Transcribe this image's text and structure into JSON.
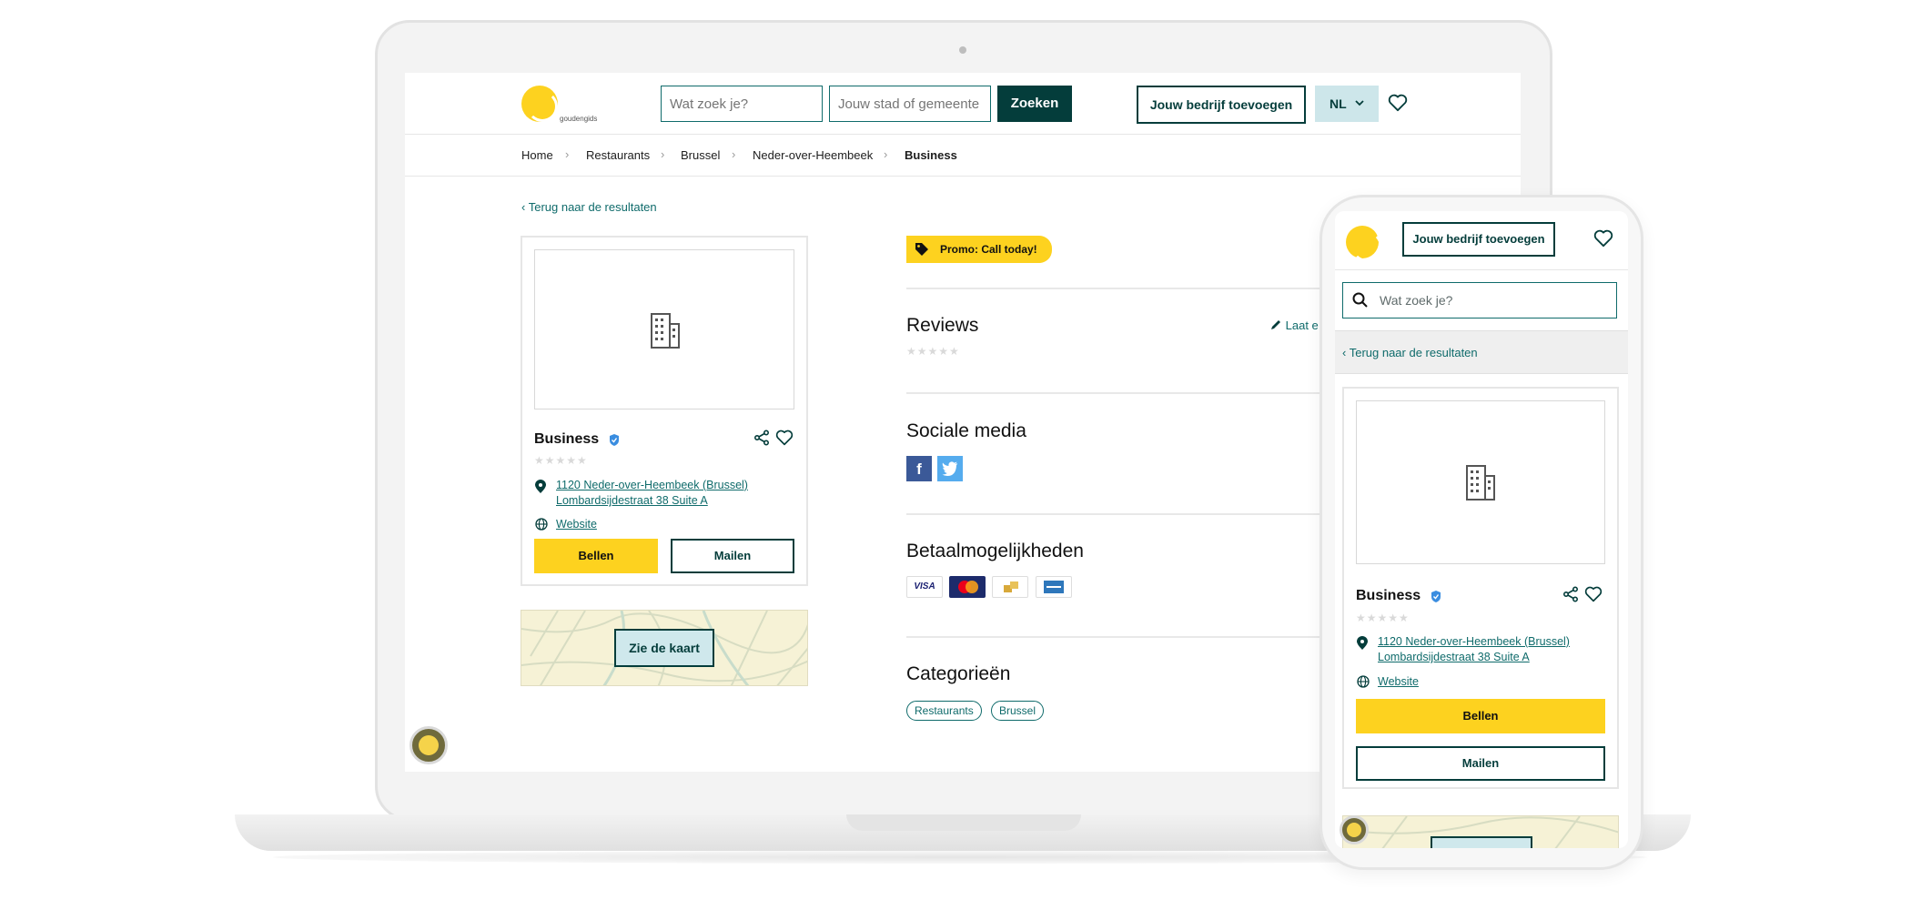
{
  "header": {
    "logo_text": "goudengids",
    "search_placeholder": "Wat zoek je?",
    "location_placeholder": "Jouw stad of gemeente",
    "search_button": "Zoeken",
    "add_business_button": "Jouw bedrijf toevoegen",
    "language": "NL"
  },
  "breadcrumb": {
    "items": [
      "Home",
      "Restaurants",
      "Brussel",
      "Neder-over-Heembeek",
      "Business"
    ]
  },
  "back_link": "Terug naar de resultaten",
  "business": {
    "name": "Business",
    "address_line1": "1120 Neder-over-Heembeek (Brussel)",
    "address_line2": "Lombardsijdestraat 38 Suite A",
    "website": "Website",
    "call_button": "Bellen",
    "mail_button": "Mailen",
    "rating_stars": 0
  },
  "map": {
    "button": "Zie de kaart"
  },
  "promo": "Promo: Call today!",
  "reviews": {
    "title": "Reviews",
    "write_link": "Laat e"
  },
  "social": {
    "title": "Sociale media"
  },
  "payment": {
    "title": "Betaalmogelijkheden",
    "methods": [
      "VISA",
      "MasterCard",
      "cash",
      "AMEX"
    ]
  },
  "categories": {
    "title": "Categorieën",
    "items": [
      "Restaurants",
      "Brussel"
    ]
  },
  "mobile": {
    "add_business_button": "Jouw bedrijf toevoegen",
    "search_placeholder": "Wat zoek je?",
    "back_link": "Terug naar de resultaten",
    "name": "Business",
    "address_line1": "1120 Neder-over-Heembeek (Brussel)",
    "address_line2": "Lombardsijdestraat 38 Suite A",
    "website": "Website",
    "call_button": "Bellen",
    "mail_button": "Mailen"
  },
  "colors": {
    "brand_yellow": "#fdd21f",
    "brand_dark": "#043d3b",
    "link_teal": "#0f6b6b",
    "facebook": "#3b5998",
    "twitter": "#55acee"
  }
}
